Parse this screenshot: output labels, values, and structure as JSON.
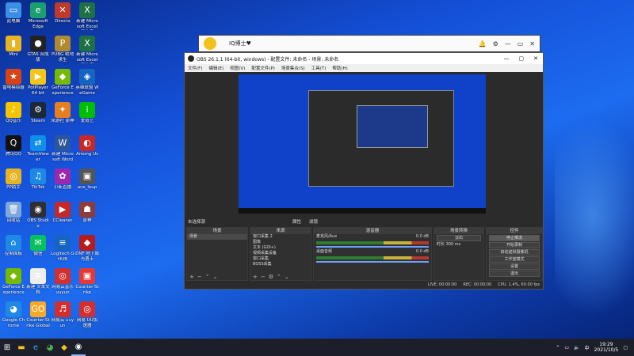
{
  "desktop": {
    "icons": [
      {
        "label": "此电脑",
        "color": "#3a8ee6",
        "glyph": "▭"
      },
      {
        "label": "Microsoft Edge",
        "color": "#1a9e6e",
        "glyph": "e"
      },
      {
        "label": "Directx",
        "color": "#c0392b",
        "glyph": "✕"
      },
      {
        "label": "新建 Microsoft Excel 工作表",
        "color": "#1e7145",
        "glyph": "X"
      },
      {
        "label": "Mini",
        "color": "#e6b422",
        "glyph": "▮"
      },
      {
        "label": "GTA5 合成版",
        "color": "#222",
        "glyph": "●"
      },
      {
        "label": "PUBG 绝地求生",
        "color": "#b08a2e",
        "glyph": "P"
      },
      {
        "label": "新建 Microsoft Excel 工作表",
        "color": "#1e7145",
        "glyph": "X"
      },
      {
        "label": "雷电模拟器",
        "color": "#d84315",
        "glyph": "★"
      },
      {
        "label": "PotPlayer 64 bit",
        "color": "#f5c518",
        "glyph": "▶"
      },
      {
        "label": "GeForce Experience",
        "color": "#76b900",
        "glyph": "◆"
      },
      {
        "label": "英雄联盟 WeGame",
        "color": "#1565c0",
        "glyph": "◈"
      },
      {
        "label": "QQ音乐",
        "color": "#f5c400",
        "glyph": "♪"
      },
      {
        "label": "Steam",
        "color": "#1b2838",
        "glyph": "⚙"
      },
      {
        "label": "米游社 原神",
        "color": "#e67e22",
        "glyph": "✦"
      },
      {
        "label": "爱奇艺",
        "color": "#00be06",
        "glyph": "i"
      },
      {
        "label": "腾讯QQ",
        "color": "#111",
        "glyph": "Q"
      },
      {
        "label": "TeamViewer",
        "color": "#0e8ee9",
        "glyph": "⇄"
      },
      {
        "label": "新建 Microsoft Word",
        "color": "#2b579a",
        "glyph": "W"
      },
      {
        "label": "Among Us",
        "color": "#c62828",
        "glyph": "◐"
      },
      {
        "label": "PP助手",
        "color": "#e6b422",
        "glyph": "◎"
      },
      {
        "label": "TikTok",
        "color": "#1e88e5",
        "glyph": "♫"
      },
      {
        "label": "小新直播",
        "color": "#9c27b0",
        "glyph": "✿"
      },
      {
        "label": "ace_loup",
        "color": "#555",
        "glyph": "▣"
      },
      {
        "label": "回收站",
        "color": "#7fa7d9",
        "glyph": "🗑"
      },
      {
        "label": "OBS Studio",
        "color": "#302e31",
        "glyph": "◉"
      },
      {
        "label": "CCleaner",
        "color": "#c62828",
        "glyph": "▶"
      },
      {
        "label": "原神",
        "color": "#8e3b3b",
        "glyph": "☗"
      },
      {
        "label": "控制面板",
        "color": "#1e88e5",
        "glyph": "⌂"
      },
      {
        "label": "微信",
        "color": "#07c160",
        "glyph": "✉"
      },
      {
        "label": "Logitech G HUB",
        "color": "#1565c0",
        "glyph": "≡"
      },
      {
        "label": "DNF 地下城与勇士",
        "color": "#b71c1c",
        "glyph": "◆"
      },
      {
        "label": "GeForce Experience",
        "color": "#76b900",
        "glyph": "◆"
      },
      {
        "label": "新建 文本文档",
        "color": "#eeeeee",
        "glyph": "≣"
      },
      {
        "label": "网易云音乐 uuyun",
        "color": "#d32f2f",
        "glyph": "◎"
      },
      {
        "label": "Counter-Strike",
        "color": "#e53935",
        "glyph": "▣"
      },
      {
        "label": "Google Chrome",
        "color": "#1e88e5",
        "glyph": "◕"
      },
      {
        "label": "Counter-Strike Global",
        "color": "#f9a825",
        "glyph": "GO"
      },
      {
        "label": "网易云 uuyun",
        "color": "#d32f2f",
        "glyph": "♬"
      },
      {
        "label": "网易 UU加速器",
        "color": "#d32f2f",
        "glyph": "◎"
      }
    ]
  },
  "back_window": {
    "user_name": "IQ博士♥",
    "controls": [
      "🔔",
      "⚙",
      "—",
      "▭",
      "✕"
    ]
  },
  "obs": {
    "title": "OBS 26.1.1 (64-bit, windows) - 配置文件: 未命名 - 场景: 未命名",
    "window_controls": [
      "—",
      "▢",
      "✕"
    ],
    "menu": [
      "文件(F)",
      "编辑(E)",
      "视图(V)",
      "配置文件(P)",
      "场景集合(S)",
      "工具(T)",
      "帮助(H)"
    ],
    "below_preview": {
      "label": "未选择源",
      "properties": "属性",
      "filters": "滤镜"
    },
    "docks": {
      "scenes": {
        "title": "场景",
        "items": [
          "场景"
        ]
      },
      "sources": {
        "title": "来源",
        "items": [
          "窗口采集 2",
          "图像",
          "文本 (GDI+)",
          "视频采集设备",
          "窗口采集",
          "BOSS采集"
        ]
      },
      "mixer": {
        "title": "混音器",
        "channels": [
          {
            "name": "麦克风/Aux",
            "db": "0.0 dB"
          },
          {
            "name": "桌面音频",
            "db": "0.0 dB"
          }
        ]
      },
      "transitions": {
        "title": "场景转换",
        "type": "淡出",
        "duration_label": "时长",
        "duration": "300 ms"
      },
      "controls": {
        "title": "控件",
        "buttons": [
          "停止推流",
          "开始录制",
          "启动虚拟摄像机",
          "工作室模式",
          "设置",
          "退出"
        ]
      }
    },
    "status": {
      "live": "LIVE: 00:00:00",
      "rec": "REC: 00:00:00",
      "cpu": "CPU: 1.4%, 60.00 fps"
    }
  },
  "taskbar": {
    "time": "19:29",
    "date": "2021/10/5",
    "lang": "中"
  }
}
